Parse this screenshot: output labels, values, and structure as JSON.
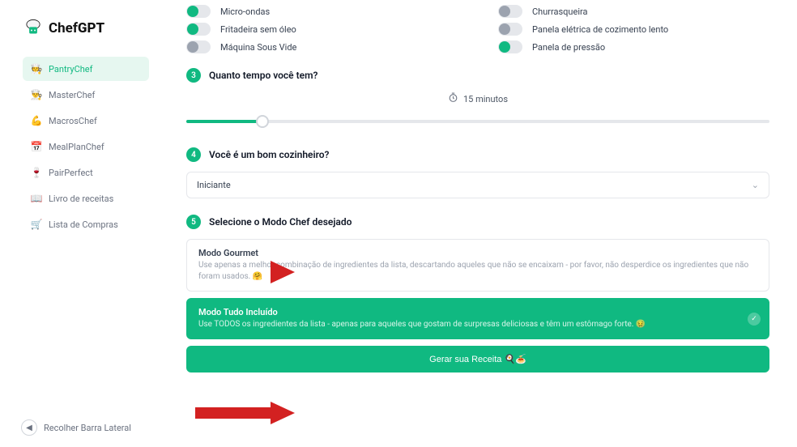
{
  "brand": {
    "name1": "Chef",
    "name2": "GPT"
  },
  "sidebar": {
    "items": [
      {
        "icon": "🧑‍🍳",
        "label": "PantryChef",
        "active": true
      },
      {
        "icon": "👨‍🍳",
        "label": "MasterChef"
      },
      {
        "icon": "💪",
        "label": "MacrosChef"
      },
      {
        "icon": "📅",
        "label": "MealPlanChef"
      },
      {
        "icon": "🍷",
        "label": "PairPerfect"
      },
      {
        "icon": "📖",
        "label": "Livro de receitas"
      },
      {
        "icon": "🛒",
        "label": "Lista de Compras"
      }
    ],
    "collapse_label": "Recolher Barra Lateral"
  },
  "tools": [
    {
      "label": "Micro-ondas",
      "on": true
    },
    {
      "label": "Churrasqueira",
      "on": false
    },
    {
      "label": "Fritadeira sem óleo",
      "on": true
    },
    {
      "label": "Panela elétrica de cozimento lento",
      "on": false
    },
    {
      "label": "Máquina Sous Vide",
      "on": false
    },
    {
      "label": "Panela de pressão",
      "on": true
    }
  ],
  "step3": {
    "num": "3",
    "title": "Quanto tempo você tem?",
    "time_label": "15 minutos"
  },
  "step4": {
    "num": "4",
    "title": "Você é um bom cozinheiro?",
    "value": "Iniciante"
  },
  "step5": {
    "num": "5",
    "title": "Selecione o Modo Chef desejado",
    "modes": [
      {
        "title": "Modo Gourmet",
        "desc": "Use apenas a melhor combinação de ingredientes da lista, descartando aqueles que não se encaixam - por favor, não desperdice os ingredientes que não foram usados. 🤗"
      },
      {
        "title": "Modo Tudo Incluído",
        "desc": "Use TODOS os ingredientes da lista - apenas para aqueles que gostam de surpresas deliciosas e têm um estômago forte. 🤢"
      }
    ]
  },
  "generate_label": "Gerar sua Receita 🍳🍝"
}
